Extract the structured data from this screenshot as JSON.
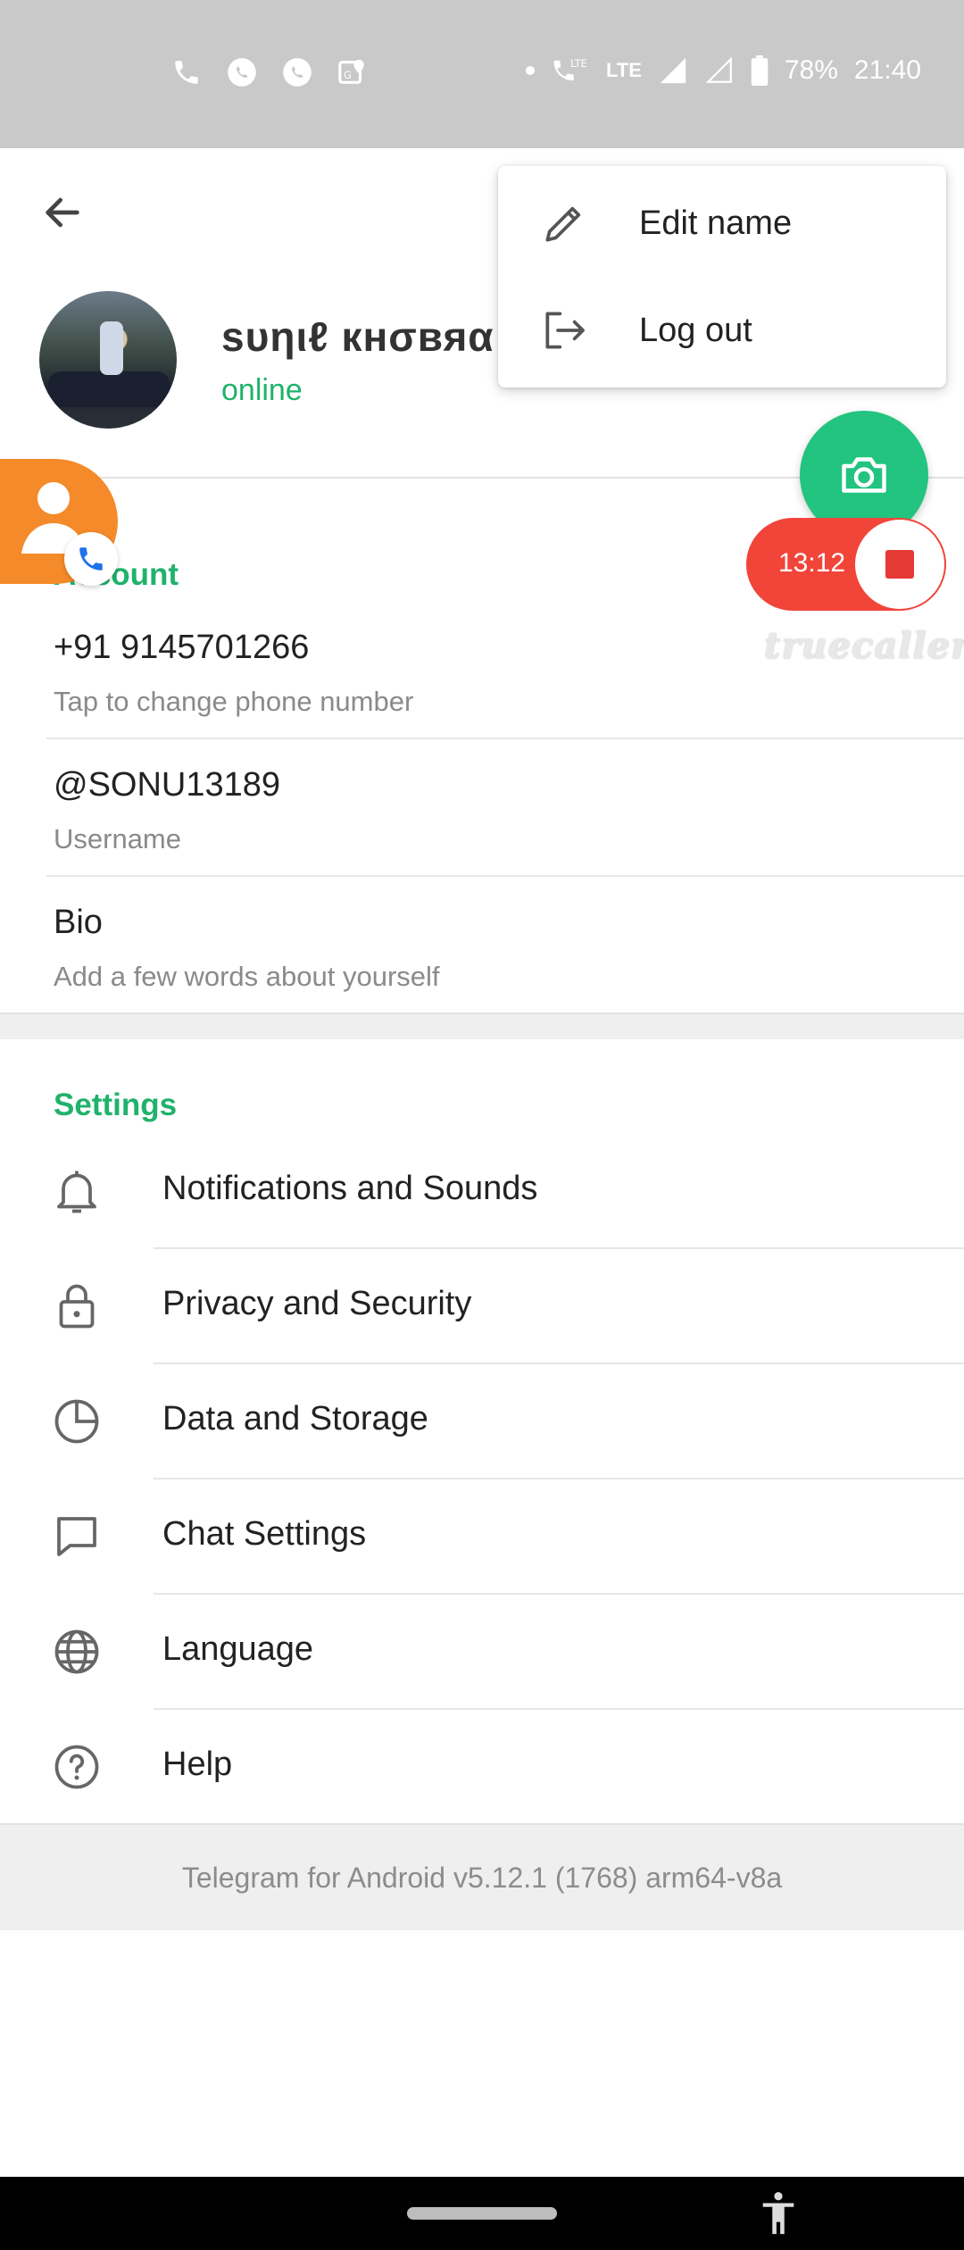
{
  "status_bar": {
    "battery": "78%",
    "time": "21:40",
    "network_1": "LTE",
    "network_2": "LTE"
  },
  "profile": {
    "name": "ѕυηιℓ кнσвяα",
    "status": "online"
  },
  "menu": {
    "items": [
      {
        "label": "Edit name",
        "icon": "pencil-icon"
      },
      {
        "label": "Log out",
        "icon": "logout-icon"
      }
    ]
  },
  "overlay": {
    "record_time": "13:12",
    "brand": "truecaller"
  },
  "account": {
    "title": "Account",
    "phone": "+91 9145701266",
    "phone_hint": "Tap to change phone number",
    "username": "@SONU13189",
    "username_hint": "Username",
    "bio": "Bio",
    "bio_hint": "Add a few words about yourself"
  },
  "settings": {
    "title": "Settings",
    "items": [
      {
        "label": "Notifications and Sounds",
        "icon": "bell-icon"
      },
      {
        "label": "Privacy and Security",
        "icon": "lock-icon"
      },
      {
        "label": "Data and Storage",
        "icon": "pie-chart-icon"
      },
      {
        "label": "Chat Settings",
        "icon": "chat-bubble-icon"
      },
      {
        "label": "Language",
        "icon": "globe-icon"
      },
      {
        "label": "Help",
        "icon": "help-icon"
      }
    ]
  },
  "footer": {
    "version": "Telegram for Android v5.12.1 (1768) arm64-v8a"
  },
  "colors": {
    "accent": "#20b26b",
    "fab": "#22c47f",
    "record": "#f1453a",
    "truecaller_avatar": "#f58a2a"
  }
}
